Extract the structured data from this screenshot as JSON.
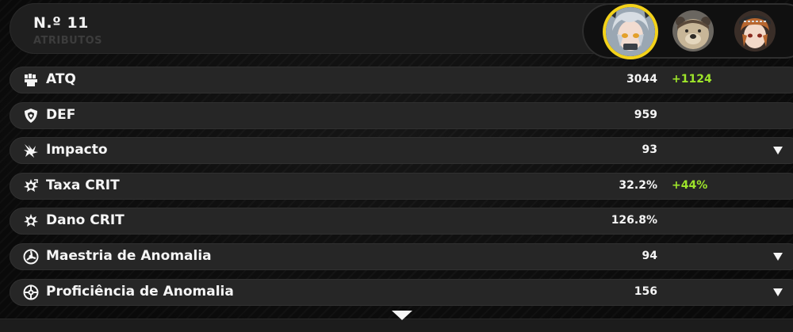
{
  "header": {
    "slot_title": "N.º 11",
    "section_subtitle": "ATRIBUTOS"
  },
  "avatars": [
    {
      "name": "silver-haired-agent",
      "selected": true
    },
    {
      "name": "bear-agent",
      "selected": false
    },
    {
      "name": "auburn-haired-agent",
      "selected": false
    }
  ],
  "stats": [
    {
      "icon": "fist-icon",
      "label": "ATQ",
      "value": "3044",
      "bonus": "+1124",
      "expandable": false
    },
    {
      "icon": "shield-icon",
      "label": "DEF",
      "value": "959",
      "bonus": "",
      "expandable": false
    },
    {
      "icon": "impact-icon",
      "label": "Impacto",
      "value": "93",
      "bonus": "",
      "expandable": true
    },
    {
      "icon": "crit-rate-icon",
      "label": "Taxa CRIT",
      "value": "32.2%",
      "bonus": "+44%",
      "expandable": false
    },
    {
      "icon": "crit-dmg-icon",
      "label": "Dano CRIT",
      "value": "126.8%",
      "bonus": "",
      "expandable": false
    },
    {
      "icon": "anomaly-mastery-icon",
      "label": "Maestria de Anomalia",
      "value": "94",
      "bonus": "",
      "expandable": true
    },
    {
      "icon": "anomaly-proficiency-icon",
      "label": "Proficiência de Anomalia",
      "value": "156",
      "bonus": "",
      "expandable": true
    }
  ],
  "colors": {
    "accent_selected": "#f3d21a",
    "bonus_text": "#9ee52a",
    "row_background": "#262626"
  }
}
